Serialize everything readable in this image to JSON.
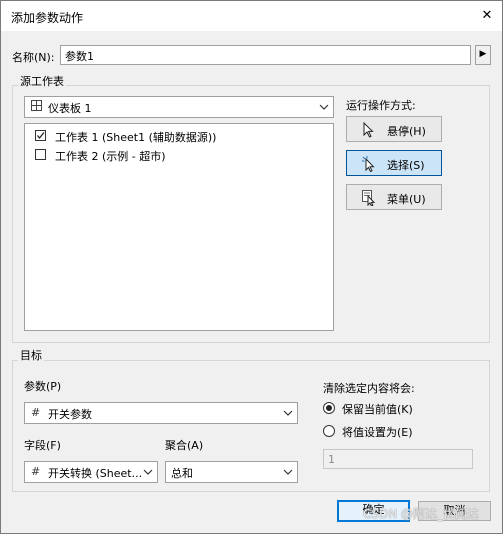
{
  "dialog": {
    "title": "添加参数动作",
    "close_glyph": "✕"
  },
  "name_field": {
    "label": "名称(N):",
    "value": "参数1",
    "expand_glyph": "▶"
  },
  "source_sheets": {
    "group_label": "源工作表",
    "dashboard": {
      "icon": "dashboard-grid-icon",
      "value": "仪表板 1"
    },
    "sheets": [
      {
        "label": "工作表 1 (Sheet1 (辅助数据源))",
        "checked": true
      },
      {
        "label": "工作表 2 (示例 - 超市)",
        "checked": false
      }
    ]
  },
  "run_action": {
    "label": "运行操作方式:",
    "options": [
      {
        "label": "悬停(H)",
        "icon": "hover-cursor-icon",
        "selected": false
      },
      {
        "label": "选择(S)",
        "icon": "select-cursor-icon",
        "selected": true
      },
      {
        "label": "菜单(U)",
        "icon": "menu-cursor-icon",
        "selected": false
      }
    ]
  },
  "target": {
    "group_label": "目标",
    "parameter": {
      "label": "参数(P)",
      "icon": "hash-icon",
      "value": "开关参数"
    },
    "field": {
      "label": "字段(F)",
      "icon": "hash-icon",
      "value": "开关转换 (Sheet..."
    },
    "aggregation": {
      "label": "聚合(A)",
      "value": "总和"
    }
  },
  "clear_selection": {
    "label": "清除选定内容将会:",
    "options": [
      {
        "label": "保留当前值(K)",
        "selected": true
      },
      {
        "label": "将值设置为(E)",
        "selected": false
      }
    ],
    "value_field": "1"
  },
  "buttons": {
    "ok": "确定",
    "cancel": "取消"
  },
  "watermark": "CSDN @阿达_优阅达"
}
